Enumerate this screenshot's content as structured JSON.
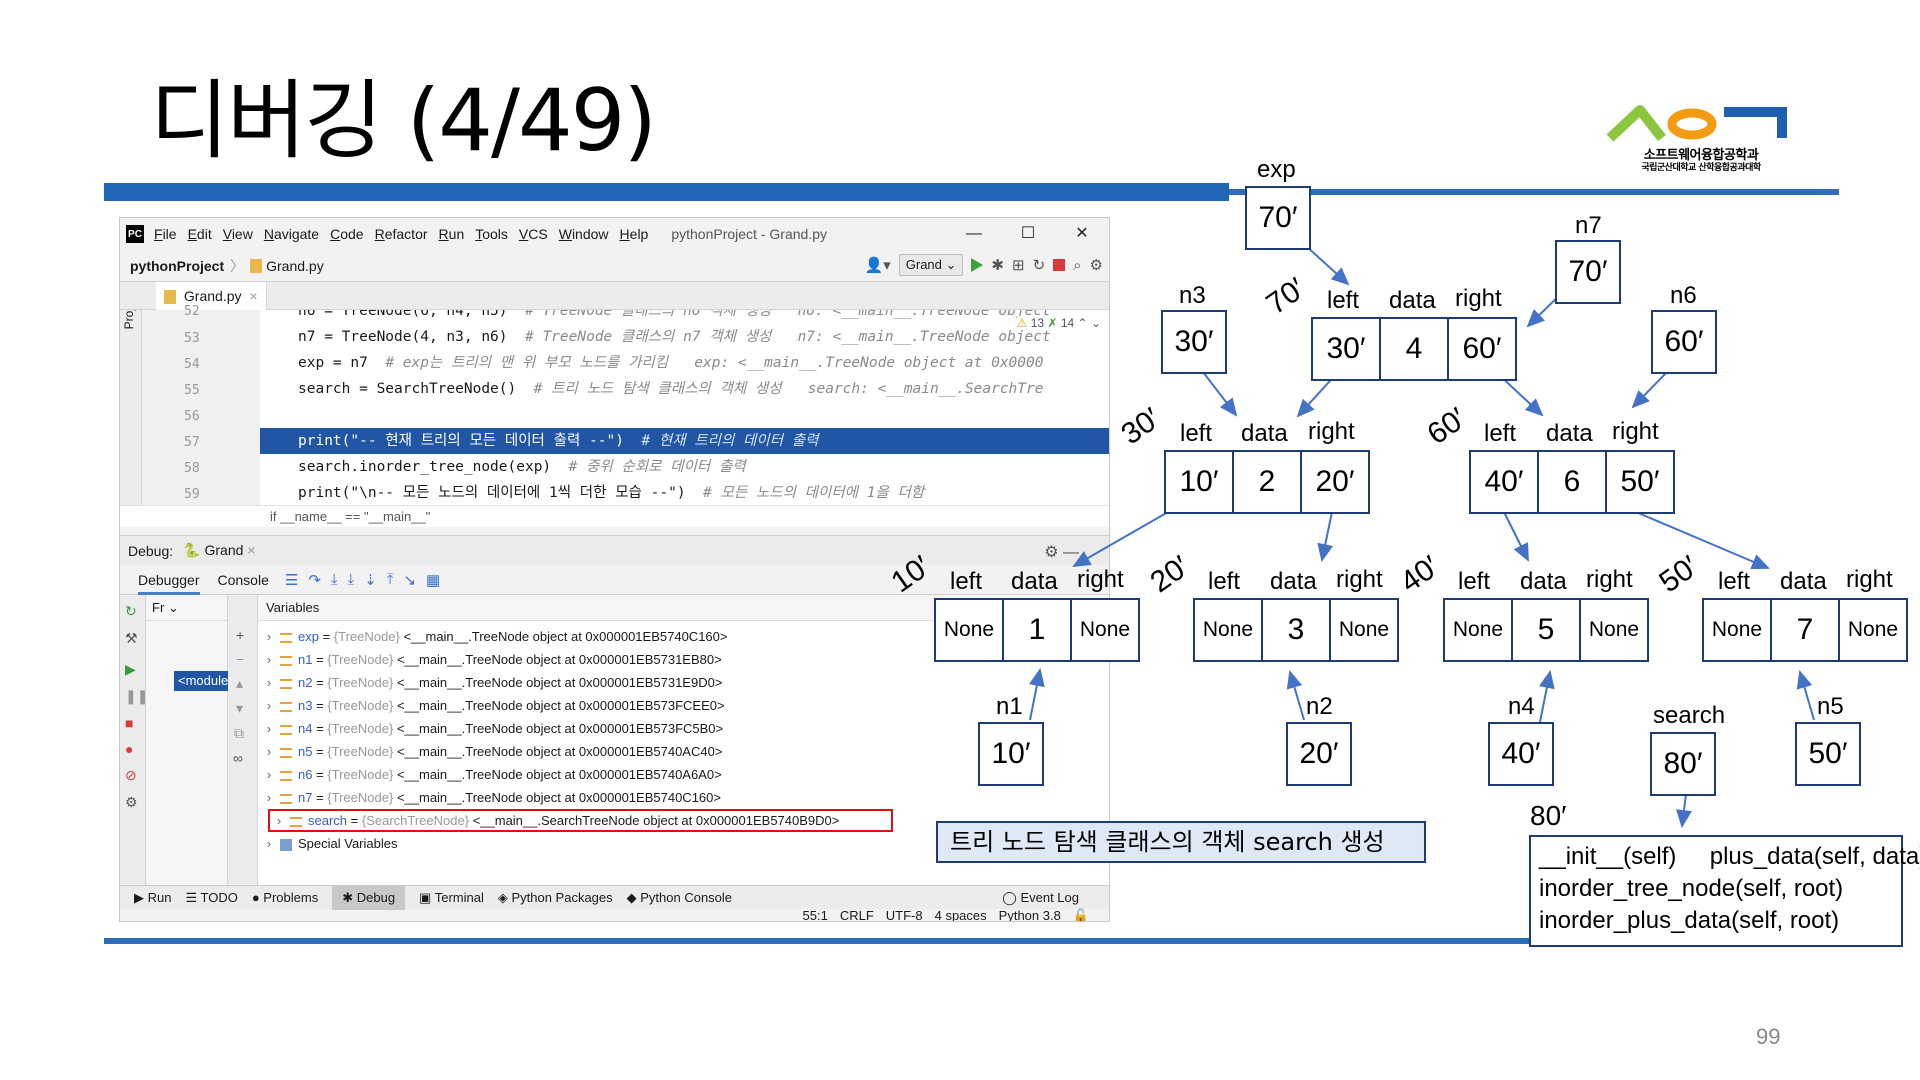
{
  "slide": {
    "title": "디버깅 (4/49)",
    "page_number": "99",
    "logo_text": "소프트웨어융합공학과",
    "logo_subtext": "국립군산대학교 산학융합공과대학"
  },
  "ide": {
    "menu": [
      "File",
      "Edit",
      "View",
      "Navigate",
      "Code",
      "Refactor",
      "Run",
      "Tools",
      "VCS",
      "Window",
      "Help"
    ],
    "window_title": "pythonProject - Grand.py",
    "window_controls": {
      "minimize": "—",
      "maximize": "☐",
      "close": "✕"
    },
    "breadcrumb": {
      "project": "pythonProject",
      "file": "Grand.py"
    },
    "run_config": "Grand",
    "side_tool_project": "Project",
    "editor_tab": "Grand.py",
    "inspection": {
      "warnings": "13",
      "weak": "14"
    },
    "code_lines": [
      {
        "num": "52",
        "code": "n6 = TreeNode(6, n4, n5)  ",
        "comment": "# TreeNode 클래스의 n6 객체 생성   n6: <__main__.TreeNode object"
      },
      {
        "num": "53",
        "code": "n7 = TreeNode(4, n3, n6)  ",
        "comment": "# TreeNode 클래스의 n7 객체 생성   n7: <__main__.TreeNode object"
      },
      {
        "num": "54",
        "code": "exp = n7  ",
        "comment": "# exp는 트리의 맨 위 부모 노드를 가리킴   exp: <__main__.TreeNode object at 0x0000"
      },
      {
        "num": "55",
        "code": "search = SearchTreeNode()  ",
        "comment": "# 트리 노드 탐색 클래스의 객체 생성   search: <__main__.SearchTre"
      },
      {
        "num": "56",
        "code": "",
        "comment": ""
      },
      {
        "num": "57",
        "code": "print(\"-- 현재 트리의 모든 데이터 출력 --\")  ",
        "comment": "# 현재 트리의 데이터 출력"
      },
      {
        "num": "58",
        "code": "search.inorder_tree_node(exp)  ",
        "comment": "# 중위 순회로 데이터 출력"
      },
      {
        "num": "59",
        "code": "print(\"\\n-- 모든 노드의 데이터에 1씩 더한 모습 --\")  ",
        "comment": "# 모든 노드의 데이터에 1을 더함"
      }
    ],
    "selected_line": "57",
    "code_breadcrumb": "if __name__ == \"__main__\"",
    "debug_label": "Debug:",
    "debug_config": "Grand",
    "debug_tabs": [
      "Debugger",
      "Console"
    ],
    "frames_header": "Fr",
    "frame_selected": "<module>",
    "variables_header": "Variables",
    "variables": [
      {
        "name": "exp",
        "type": "{TreeNode}",
        "value": "<__main__.TreeNode object at 0x000001EB5740C160>"
      },
      {
        "name": "n1",
        "type": "{TreeNode}",
        "value": "<__main__.TreeNode object at 0x000001EB5731EB80>"
      },
      {
        "name": "n2",
        "type": "{TreeNode}",
        "value": "<__main__.TreeNode object at 0x000001EB5731E9D0>"
      },
      {
        "name": "n3",
        "type": "{TreeNode}",
        "value": "<__main__.TreeNode object at 0x000001EB573FCEE0>"
      },
      {
        "name": "n4",
        "type": "{TreeNode}",
        "value": "<__main__.TreeNode object at 0x000001EB573FC5B0>"
      },
      {
        "name": "n5",
        "type": "{TreeNode}",
        "value": "<__main__.TreeNode object at 0x000001EB5740AC40>"
      },
      {
        "name": "n6",
        "type": "{TreeNode}",
        "value": "<__main__.TreeNode object at 0x000001EB5740A6A0>"
      },
      {
        "name": "n7",
        "type": "{TreeNode}",
        "value": "<__main__.TreeNode object at 0x000001EB5740C160>"
      },
      {
        "name": "search",
        "type": "{SearchTreeNode}",
        "value": "<__main__.SearchTreeNode object at 0x000001EB5740B9D0>"
      }
    ],
    "special_variables": "Special Variables",
    "bottom_tabs": [
      "Run",
      "TODO",
      "Problems",
      "Debug",
      "Terminal",
      "Python Packages",
      "Python Console"
    ],
    "event_log": "Event Log",
    "status": [
      "55:1",
      "CRLF",
      "UTF-8",
      "4 spaces",
      "Python 3.8"
    ]
  },
  "diagram": {
    "caption": "트리 노드 탐색 클래스의 객체 search 생성",
    "field_labels": {
      "left": "left",
      "data": "data",
      "right": "right"
    },
    "pointers": [
      {
        "name": "exp",
        "value": "70′"
      },
      {
        "name": "n7",
        "value": "70′"
      },
      {
        "name": "n3",
        "value": "30′"
      },
      {
        "name": "n6",
        "value": "60′"
      },
      {
        "name": "n1",
        "value": "10′"
      },
      {
        "name": "n2",
        "value": "20′"
      },
      {
        "name": "n4",
        "value": "40′"
      },
      {
        "name": "n5",
        "value": "50′"
      },
      {
        "name": "search",
        "value": "80′"
      }
    ],
    "nodes": [
      {
        "addr": "70′",
        "left": "30′",
        "data": "4",
        "right": "60′"
      },
      {
        "addr": "30′",
        "left": "10′",
        "data": "2",
        "right": "20′"
      },
      {
        "addr": "60′",
        "left": "40′",
        "data": "6",
        "right": "50′"
      },
      {
        "addr": "10′",
        "left": "None",
        "data": "1",
        "right": "None"
      },
      {
        "addr": "20′",
        "left": "None",
        "data": "3",
        "right": "None"
      },
      {
        "addr": "40′",
        "left": "None",
        "data": "5",
        "right": "None"
      },
      {
        "addr": "50′",
        "left": "None",
        "data": "7",
        "right": "None"
      }
    ],
    "search_addr": "80′",
    "methods": [
      "__init__(self)     plus_data(self, data)",
      "inorder_tree_node(self, root)",
      "inorder_plus_data(self, root)"
    ]
  }
}
